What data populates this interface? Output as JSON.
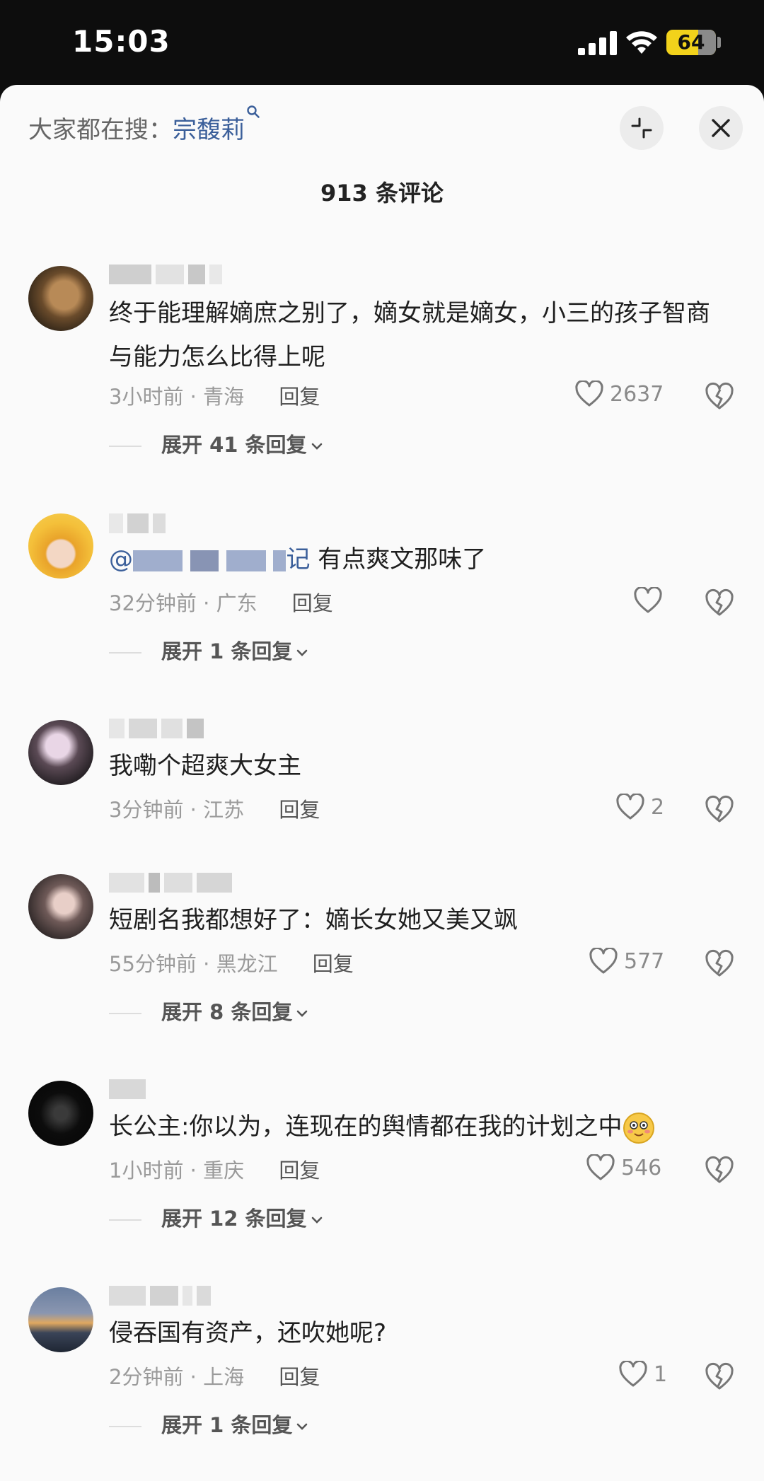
{
  "status_bar": {
    "time": "15:03",
    "battery": "64",
    "battery_level": 0.64
  },
  "header": {
    "search_prefix": "大家都在搜：",
    "search_keyword": "宗馥莉",
    "comment_count": "913 条评论"
  },
  "comments": [
    {
      "text": "终于能理解嫡庶之别了，嫡女就是嫡女，小三的孩子智商与能力怎么比得上呢",
      "time": "3小时前",
      "sep": "·",
      "location": "青海",
      "reply": "回复",
      "likes": "2637",
      "expand": "展开 41 条回复"
    },
    {
      "mention_tail": "记",
      "text": " 有点爽文那味了",
      "time": "32分钟前",
      "sep": "·",
      "location": "广东",
      "reply": "回复",
      "likes": "",
      "expand": "展开 1 条回复"
    },
    {
      "text": "我嘞个超爽大女主",
      "time": "3分钟前",
      "sep": "·",
      "location": "江苏",
      "reply": "回复",
      "likes": "2",
      "expand": ""
    },
    {
      "text": "短剧名我都想好了：嫡长女她又美又飒",
      "time": "55分钟前",
      "sep": "·",
      "location": "黑龙江",
      "reply": "回复",
      "likes": "577",
      "expand": "展开 8 条回复"
    },
    {
      "text": "长公主:你以为，连现在的舆情都在我的计划之中",
      "time": "1小时前",
      "sep": "·",
      "location": "重庆",
      "reply": "回复",
      "likes": "546",
      "expand": "展开 12 条回复"
    },
    {
      "text": "侵吞国有资产，还吹她呢?",
      "time": "2分钟前",
      "sep": "·",
      "location": "上海",
      "reply": "回复",
      "likes": "1",
      "expand": "展开 1 条回复"
    }
  ],
  "colors": {
    "accent": "#3b5f9a",
    "sheet": "#fafafa",
    "muted": "#9a9a9a",
    "battery": "#f2d21b"
  }
}
